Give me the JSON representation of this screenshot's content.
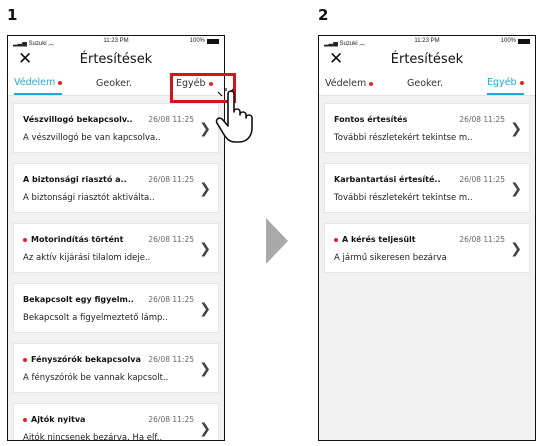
{
  "steps": [
    {
      "label": "1"
    },
    {
      "label": "2"
    }
  ],
  "phones": [
    {
      "status": {
        "carrier": "Suzuki",
        "time": "11:23 PM",
        "battery": "100%"
      },
      "header": {
        "title": "Értesítések"
      },
      "tabs": [
        {
          "label": "Védelem",
          "dot": true
        },
        {
          "label": "Geoker.",
          "dot": false
        },
        {
          "label": "Egyéb",
          "dot": true
        }
      ],
      "cards": [
        {
          "title": "Vészvillogó bekapcsolv..",
          "date": "26/08 11:25",
          "body": "A vészvillogó be van kapcsolva..",
          "unread": false
        },
        {
          "title": "A biztonsági riasztó a..",
          "date": "26/08 11:25",
          "body": "A biztonsági riasztót aktiválta..",
          "unread": false
        },
        {
          "title": "Motorindítás történt",
          "date": "26/08 11:25",
          "body": "Az aktív kijárási tilalom ideje..",
          "unread": true
        },
        {
          "title": "Bekapcsolt egy figyelm..",
          "date": "26/08 11:25",
          "body": "Bekapcsolt a figyelmeztető lámp..",
          "unread": false
        },
        {
          "title": "Fényszórók bekapcsolva",
          "date": "26/08 11:25",
          "body": "A fényszórók be vannak kapcsolt..",
          "unread": true
        },
        {
          "title": "Ajtók nyitva",
          "date": "26/08 11:25",
          "body": "Ajtók nincsenek bezárva. Ha elf..",
          "unread": true
        }
      ]
    },
    {
      "status": {
        "carrier": "Suzuki",
        "time": "11:23 PM",
        "battery": "100%"
      },
      "header": {
        "title": "Értesítések"
      },
      "tabs": [
        {
          "label": "Védelem",
          "dot": true
        },
        {
          "label": "Geoker.",
          "dot": false
        },
        {
          "label": "Egyéb",
          "dot": true
        }
      ],
      "cards": [
        {
          "title": "Fontos értesítés",
          "date": "26/08 11:25",
          "body": "További részletekért tekintse m..",
          "unread": false
        },
        {
          "title": "Karbantartási értesíté..",
          "date": "26/08 11:25",
          "body": "További részletekért tekintse m..",
          "unread": false
        },
        {
          "title": "A kérés teljesült",
          "date": "26/08 11:25",
          "body": "A jármű sikeresen bezárva",
          "unread": true
        }
      ]
    }
  ],
  "colors": {
    "accent": "#1fa8d8",
    "highlight": "#d4141b",
    "unread_dot": "#e0262a"
  },
  "icons": {
    "close": "close-icon",
    "chevron": "chevron-right-icon",
    "pointer": "hand-pointer-icon",
    "arrow": "step-arrow-icon"
  }
}
